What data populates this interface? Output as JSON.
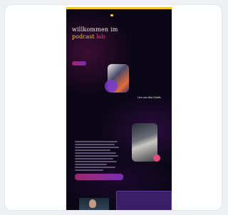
{
  "hero": {
    "line1": "willkommen im",
    "line2_main": "podcast",
    "line2_accent": "lab"
  },
  "images": {
    "top_caption": "Live aus dem Studio"
  }
}
